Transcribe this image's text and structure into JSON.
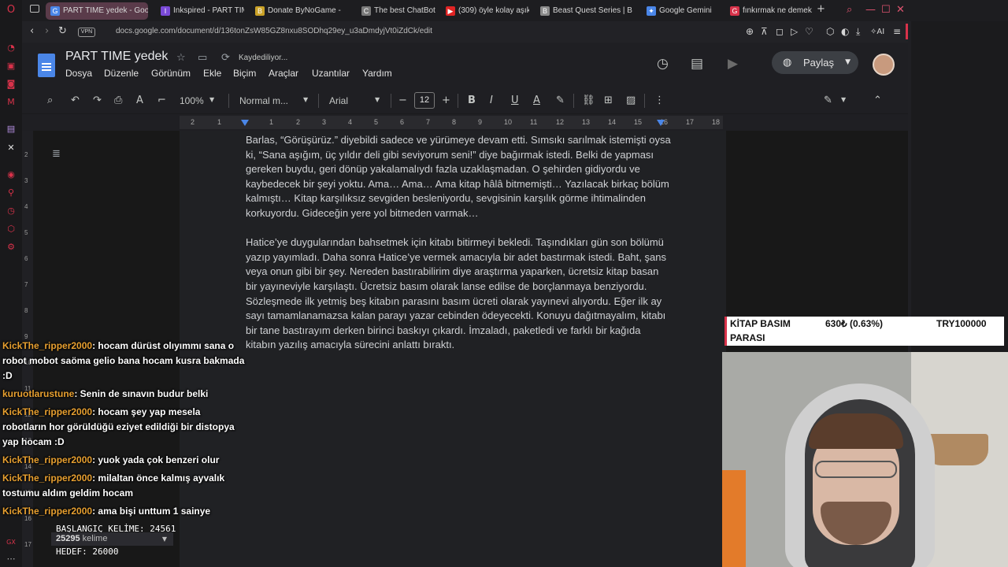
{
  "browser": {
    "tabs": [
      {
        "title": "PART TIME yedek - Google",
        "icon": "G",
        "color": "#4a86e8",
        "active": true
      },
      {
        "title": "Inkspired - PART TIME",
        "icon": "I",
        "color": "#7a4ad8"
      },
      {
        "title": "Donate ByNoGame -",
        "icon": "B",
        "color": "#caa227"
      },
      {
        "title": "The best ChatBot and",
        "icon": "C",
        "color": "#7a7a7a"
      },
      {
        "title": "(309) öyle kolay aşık o",
        "icon": "▶",
        "color": "#e02424"
      },
      {
        "title": "Beast Quest Series | B",
        "icon": "B",
        "color": "#8a8a8a"
      },
      {
        "title": "Google Gemini",
        "icon": "✦",
        "color": "#4a86e8"
      },
      {
        "title": "fınkırmak ne demek - ",
        "icon": "G",
        "color": "#d8324a"
      }
    ],
    "vpn_label": "VPN",
    "url": "docs.google.com/document/d/136tonZsW85GZ8nxu8SODhq29ey_u3aDmdyjVt0iZdCk/edit",
    "ai_label": "AI"
  },
  "docs": {
    "title": "PART TIME yedek",
    "saving_status": "Kaydediliyor...",
    "menu": [
      "Dosya",
      "Düzenle",
      "Görünüm",
      "Ekle",
      "Biçim",
      "Araçlar",
      "Uzantılar",
      "Yardım"
    ],
    "share_label": "Paylaş",
    "toolbar": {
      "zoom": "100%",
      "style": "Normal m...",
      "font": "Arial",
      "font_size": "12"
    },
    "ruler_numbers": [
      "2",
      "1",
      "1",
      "2",
      "3",
      "4",
      "5",
      "6",
      "7",
      "8",
      "9",
      "10",
      "11",
      "12",
      "13",
      "14",
      "15",
      "16",
      "17",
      "18"
    ],
    "vruler_numbers": [
      "2",
      "3",
      "4",
      "5",
      "6",
      "7",
      "8",
      "9",
      "10",
      "11",
      "12",
      "13",
      "14",
      "15",
      "16",
      "17"
    ],
    "paragraphs": [
      "Barlas, “Görüşürüz.” diyebildi sadece ve yürümeye devam etti. Sımsıkı sarılmak istemişti oysa ki, “Sana aşığım, üç yıldır deli gibi seviyorum seni!” diye bağırmak istedi. Belki de yapması gereken buydu, geri dönüp yakalamalıydı fazla uzaklaşmadan. O şehirden gidiyordu ve kaybedecek bir şeyi yoktu. Ama… Ama… Ama kitap hâlâ bitmemişti… Yazılacak birkaç bölüm kalmıştı… Kitap karşılıksız sevgiden besleniyordu, sevgisinin karşılık görme ihtimalinden korkuyordu. Gideceğin yere yol bitmeden varmak…",
      "Hatice’ye duygularından bahsetmek için kitabı bitirmeyi bekledi. Taşındıkları gün son bölümü yazıp yayımladı. Daha sonra Hatice’ye vermek amacıyla bir adet bastırmak istedi. Baht, şans veya onun gibi bir şey. Nereden bastırabilirim diye araştırma yaparken, ücretsiz kitap basan bir yayıneviyle karşılaştı. Ücretsiz basım olarak lanse edilse de borçlanmaya benziyordu. Sözleşmede ilk yetmiş beş kitabın parasını basım ücreti olarak yayınevi alıyordu. Eğer ilk ay sayı tamamlanamazsa kalan parayı yazar cebinden ödeyecekti. Konuyu dağıtmayalım, kitabı bir tane bastırayım derken birinci baskıyı çıkardı. İmzaladı, paketledi ve farklı bir kağıda kitabın yazılış amacıyla sürecini anlattı bıraktı."
    ]
  },
  "chat": [
    {
      "user": "KickThe_ripper2000",
      "text": ": hocam dürüst olıyımmı sana o robot mobot saöma gelio bana hocam kusra bakmada :D"
    },
    {
      "user": "kuruotlarustune",
      "text": ": Senin de sınavın budur belki"
    },
    {
      "user": "KickThe_ripper2000",
      "text": ": hocam şey yap mesela robotların hor görüldüğü eziyet edildiği bir distopya yap hocam :D"
    },
    {
      "user": "KickThe_ripper2000",
      "text": ": yuok yada çok benzeri olur"
    },
    {
      "user": "KickThe_ripper2000",
      "text": ": milaltan önce kalmış ayvalık tostumu aldım geldim hocam"
    },
    {
      "user": "KickThe_ripper2000",
      "text": ": ama bişi unttum 1 sainye"
    }
  ],
  "word_counter": {
    "start_line": "BAŞLANGIÇ KELİME: 24561",
    "current_count": "25295",
    "current_unit": "kelime",
    "target_line": "HEDEF: 26000"
  },
  "donation_goal": {
    "label_line1": "KİTAP BASIM",
    "label_line2": "PARASI",
    "amount": "630₺ (0.63%)",
    "target": "TRY100000",
    "accent": "#d8324a"
  },
  "colors": {
    "chat_username": "#e8a030",
    "opera_accent": "#d8324a",
    "docs_blue": "#4a86e8"
  }
}
